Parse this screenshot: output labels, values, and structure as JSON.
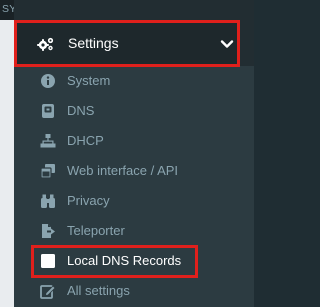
{
  "section": {
    "title": "SYSTEM"
  },
  "settings": {
    "label": "Settings",
    "icon": "cogs-icon",
    "expanded": true
  },
  "submenu": [
    {
      "label": "System",
      "icon": "info-circle-icon",
      "active": false
    },
    {
      "label": "DNS",
      "icon": "server-icon",
      "active": false
    },
    {
      "label": "DHCP",
      "icon": "sitemap-icon",
      "active": false
    },
    {
      "label": "Web interface / API",
      "icon": "window-restore-icon",
      "active": false
    },
    {
      "label": "Privacy",
      "icon": "binoculars-icon",
      "active": false
    },
    {
      "label": "Teleporter",
      "icon": "file-export-icon",
      "active": false
    },
    {
      "label": "Local DNS Records",
      "icon": "address-card-icon",
      "active": true
    },
    {
      "label": "All settings",
      "icon": "edit-icon",
      "active": false
    }
  ],
  "colors": {
    "sidebar_bg": "#222d32",
    "submenu_bg": "#2c3b41",
    "text_muted": "#8aa4af",
    "text_active": "#ffffff",
    "highlight": "#e0201c"
  }
}
